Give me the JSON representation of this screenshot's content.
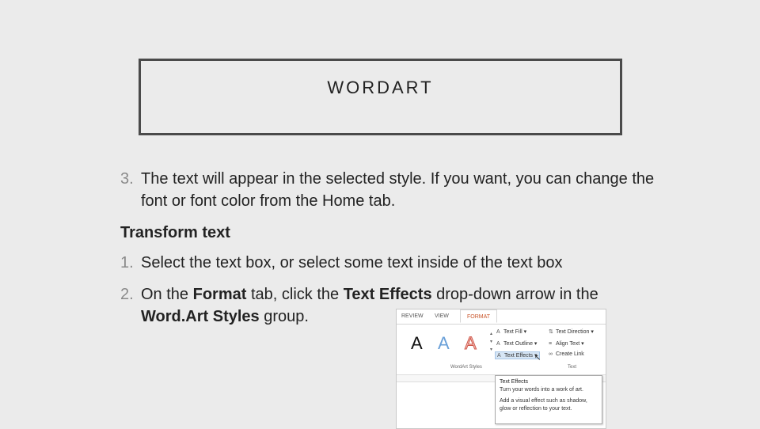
{
  "slide": {
    "title": "WORDART",
    "step3": {
      "number": "3.",
      "text": "The text will appear in the selected style. If you want, you can change the font or font color from the Home tab."
    },
    "heading": "Transform text",
    "step1": {
      "number": "1.",
      "text": "Select the text box, or select some text inside of the text box"
    },
    "step2": {
      "number": "2.",
      "pre": "On the ",
      "b1": "Format",
      "mid1": " tab, click the ",
      "b2": "Text Effects",
      "mid2": " drop-down arrow in the ",
      "b3": "Word.Art Styles",
      "post": " group."
    }
  },
  "screenshot": {
    "tabs": [
      "REVIEW",
      "VIEW",
      "FORMAT"
    ],
    "wordart_letters": [
      "A",
      "A",
      "A"
    ],
    "ribbon_items": {
      "text_fill": "Text Fill",
      "text_outline": "Text Outline",
      "text_effects": "Text Effects",
      "text_direction": "Text Direction",
      "align_text": "Align Text",
      "create_link": "Create Link"
    },
    "groups": [
      "WordArt Styles",
      "Text"
    ],
    "tooltip": {
      "title": "Text Effects",
      "line1": "Turn your words into a work of art.",
      "line2": "Add a visual effect such as shadow, glow or reflection to your text."
    }
  }
}
